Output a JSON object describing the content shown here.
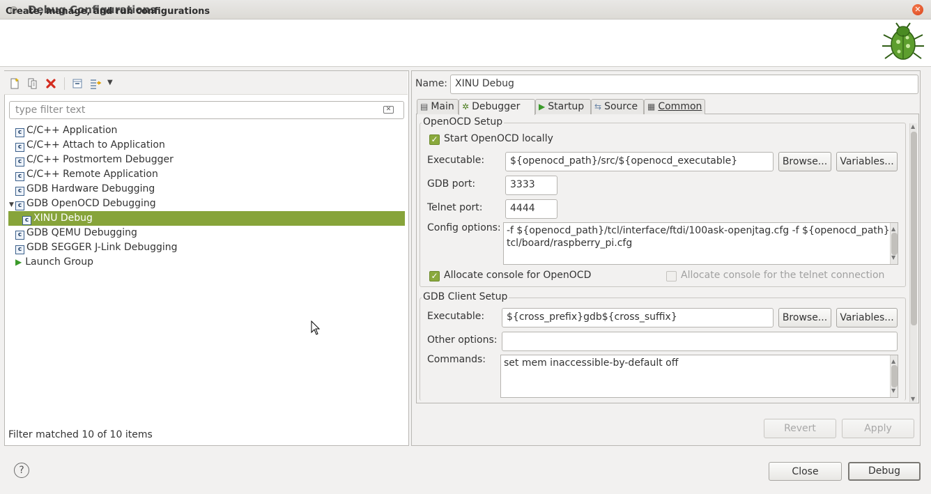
{
  "window": {
    "title": "Debug Configurations"
  },
  "banner": {
    "subtitle": "Create, manage, and run configurations",
    "icon": "bug-icon"
  },
  "toolbar": {
    "buttons": [
      "new-config-icon",
      "duplicate-icon",
      "delete-icon",
      "collapse-all-icon",
      "filter-icon",
      "dropdown-icon"
    ]
  },
  "filter": {
    "placeholder": "type filter text",
    "status": "Filter matched 10 of 10 items"
  },
  "tree": {
    "items": [
      {
        "label": "C/C++ Application"
      },
      {
        "label": "C/C++ Attach to Application"
      },
      {
        "label": "C/C++ Postmortem Debugger"
      },
      {
        "label": "C/C++ Remote Application"
      },
      {
        "label": "GDB Hardware Debugging"
      },
      {
        "label": "GDB OpenOCD Debugging"
      },
      {
        "label": "XINU Debug"
      },
      {
        "label": "GDB QEMU Debugging"
      },
      {
        "label": "GDB SEGGER J-Link Debugging"
      },
      {
        "label": "Launch Group"
      }
    ]
  },
  "config": {
    "name_label": "Name:",
    "name_value": "XINU Debug",
    "tabs": [
      "Main",
      "Debugger",
      "Startup",
      "Source",
      "Common"
    ],
    "active_tab": "Debugger"
  },
  "openocd": {
    "group_label": "OpenOCD Setup",
    "start_locally": "Start OpenOCD locally",
    "executable_label": "Executable:",
    "executable_value": "${openocd_path}/src/${openocd_executable}",
    "browse": "Browse...",
    "variables": "Variables...",
    "gdb_port_label": "GDB port:",
    "gdb_port_value": "3333",
    "telnet_port_label": "Telnet port:",
    "telnet_port_value": "4444",
    "config_options_label": "Config options:",
    "config_options_line1": "-f ${openocd_path}/tcl/interface/ftdi/100ask-openjtag.cfg -f ${openocd_path}/",
    "config_options_line2": "tcl/board/raspberry_pi.cfg",
    "allocate_console": "Allocate console for OpenOCD",
    "allocate_telnet_console": "Allocate console for the telnet connection"
  },
  "gdb_client": {
    "group_label": "GDB Client Setup",
    "executable_label": "Executable:",
    "executable_value": "${cross_prefix}gdb${cross_suffix}",
    "browse": "Browse...",
    "variables": "Variables...",
    "other_options_label": "Other options:",
    "other_options_value": "",
    "commands_label": "Commands:",
    "commands_value": "set mem inaccessible-by-default off"
  },
  "actions": {
    "revert": "Revert",
    "apply": "Apply",
    "close": "Close",
    "debug": "Debug",
    "help": "?"
  },
  "colors": {
    "selection": "#87a43a",
    "checkbox": "#8aa93c",
    "close_button": "#d8431a"
  }
}
